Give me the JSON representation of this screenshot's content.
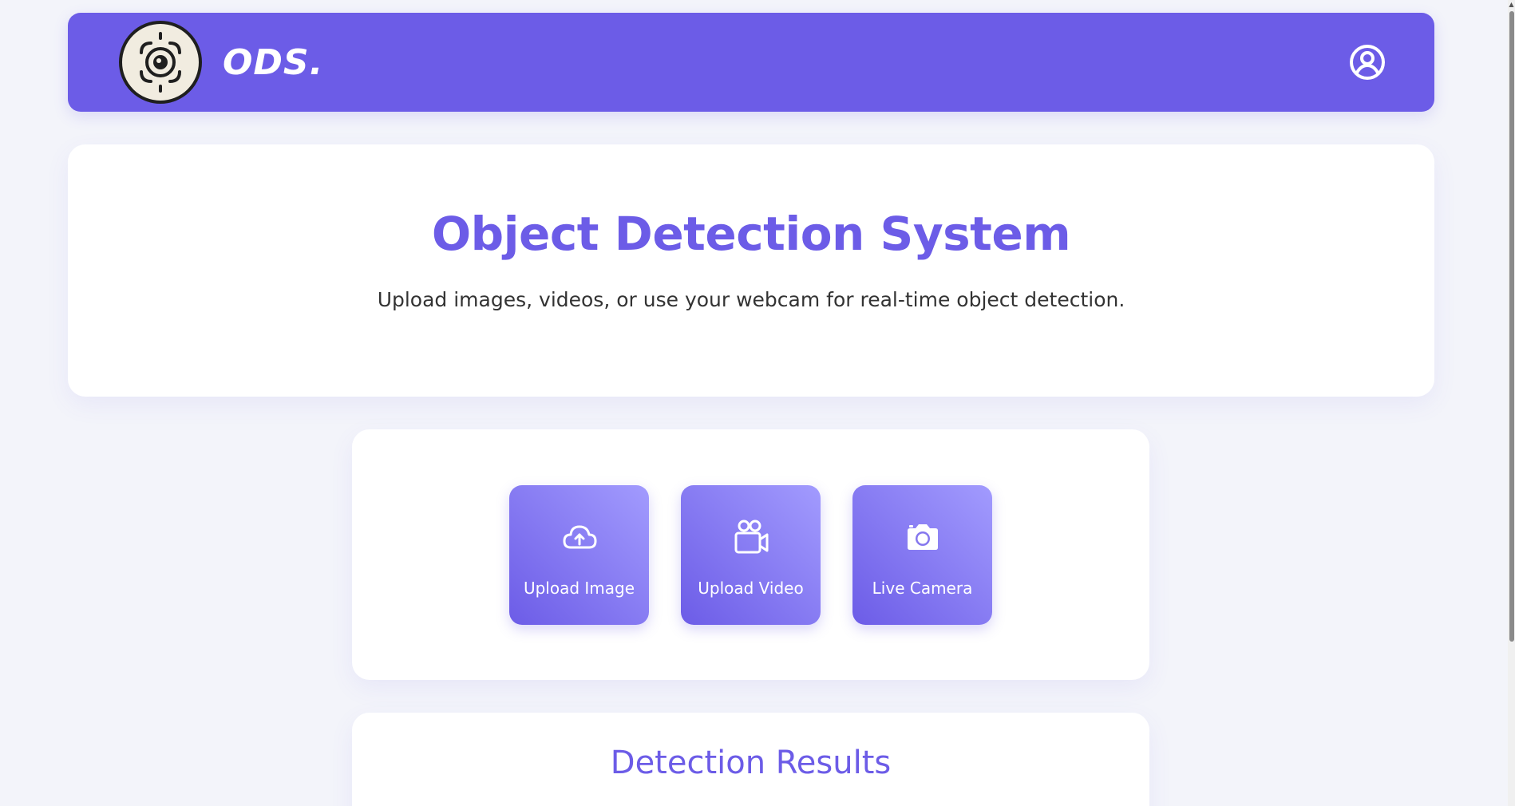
{
  "navbar": {
    "brand": "ODS.",
    "logo_icon": "camera-lens-logo",
    "user_icon": "user-circle-icon",
    "color": "#6c5ce7"
  },
  "hero": {
    "title": "Object Detection System",
    "subtitle": "Upload images, videos, or use your webcam for real-time object detection."
  },
  "options": [
    {
      "label": "Upload Image",
      "icon": "cloud-upload-icon"
    },
    {
      "label": "Upload Video",
      "icon": "video-camera-icon"
    },
    {
      "label": "Live Camera",
      "icon": "camera-icon"
    }
  ],
  "results": {
    "title": "Detection Results"
  },
  "colors": {
    "accent": "#6c5ce7",
    "accent_light": "#a29bfe",
    "background": "#f3f4fa"
  }
}
